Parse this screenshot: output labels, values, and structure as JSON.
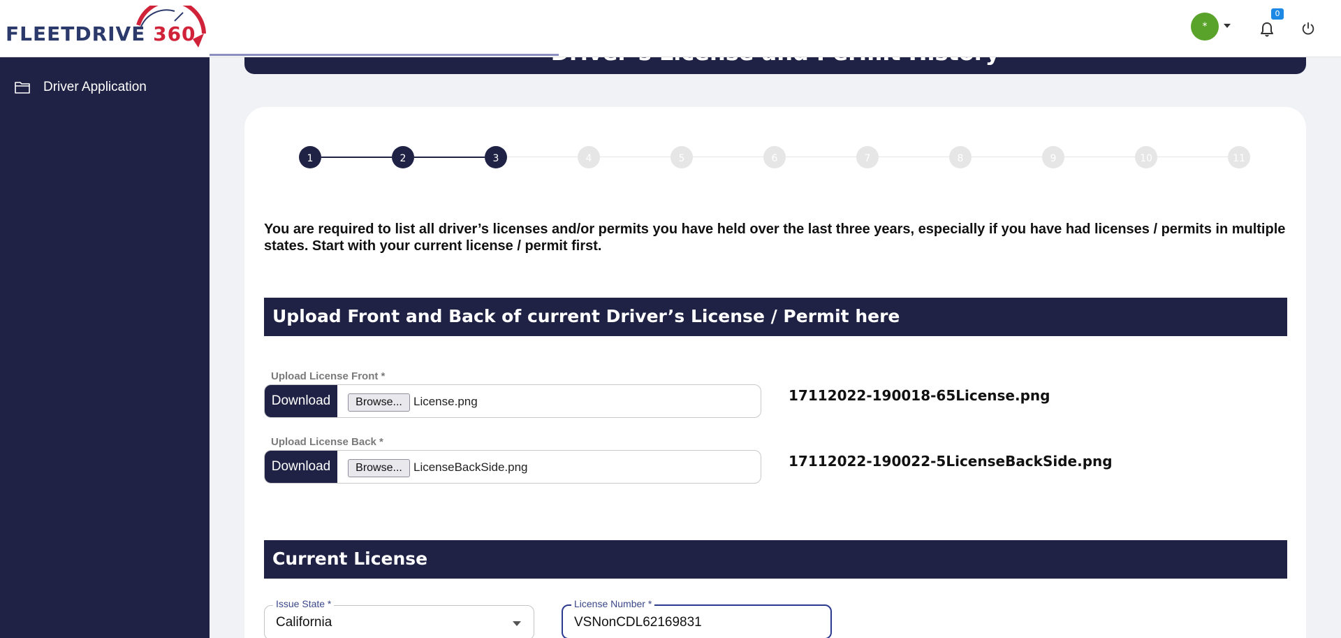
{
  "app": {
    "brand_text": "FLEETDRIVE",
    "brand_number": "360",
    "brand_color": "#2b3a6b",
    "brand_accent": "#d0233a"
  },
  "header": {
    "avatar_text": "*",
    "notification_count": "0",
    "icons": [
      "chevron-down-icon",
      "bell-icon",
      "power-icon"
    ]
  },
  "sidebar": {
    "items": [
      {
        "label": "Driver Application",
        "icon": "folder-icon"
      }
    ]
  },
  "page": {
    "title": "Driver’s License and Permit History",
    "intro": "You are required to list all driver’s licenses and/or permits you have held over the last three years, especially if you have had licenses / permits in multiple states. Start with your current license / permit first."
  },
  "stepper": {
    "steps": [
      "1",
      "2",
      "3",
      "4",
      "5",
      "6",
      "7",
      "8",
      "9",
      "10",
      "11"
    ],
    "active_count": 3,
    "active_color": "#1f2244",
    "inactive_color": "#e6e6e6"
  },
  "upload_section": {
    "heading": "Upload Front and Back of current Driver’s License / Permit here",
    "front": {
      "label": "Upload License Front *",
      "download_label": "Download",
      "browse_label": "Browse...",
      "file_name": "License.png",
      "server_file": "17112022-190018-65License.png"
    },
    "back": {
      "label": "Upload License Back *",
      "download_label": "Download",
      "browse_label": "Browse...",
      "file_name": "LicenseBackSide.png",
      "server_file": "17112022-190022-5LicenseBackSide.png"
    }
  },
  "current_license": {
    "heading": "Current License",
    "issue_state": {
      "label": "Issue State *",
      "value": "California"
    },
    "license_number": {
      "label": "License Number *",
      "value": "VSNonCDL62169831"
    }
  }
}
